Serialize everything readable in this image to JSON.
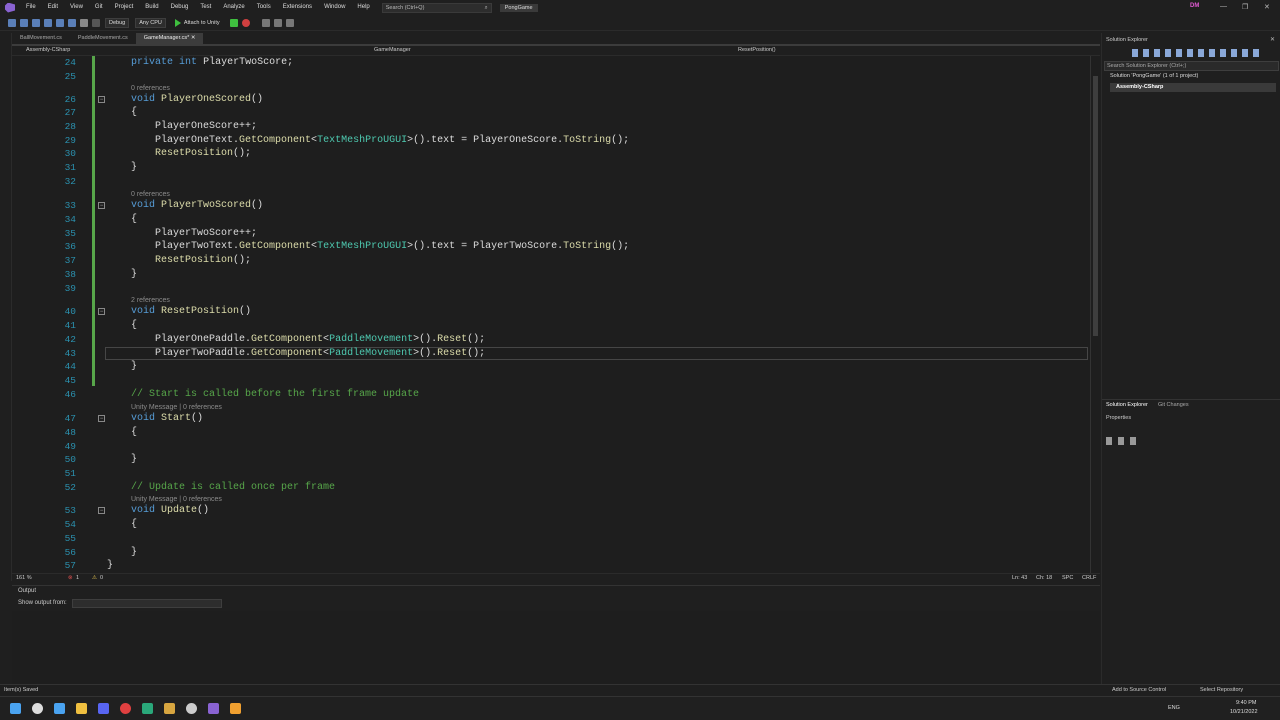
{
  "menu": {
    "items": [
      "File",
      "Edit",
      "View",
      "Git",
      "Project",
      "Build",
      "Debug",
      "Test",
      "Analyze",
      "Tools",
      "Extensions",
      "Window",
      "Help"
    ],
    "search_placeholder": "Search (Ctrl+Q)",
    "project": "PongGame",
    "user_initials": "DM"
  },
  "toolbar": {
    "config": "Debug",
    "platform": "Any CPU",
    "attach": "Attach to Unity"
  },
  "tabs": [
    {
      "label": "BallMovement.cs"
    },
    {
      "label": "PaddleMovement.cs"
    },
    {
      "label": "GameManager.cs*"
    }
  ],
  "navbar": {
    "assembly": "Assembly-CSharp",
    "class": "GameManager",
    "member": "ResetPosition()"
  },
  "editor": {
    "line_numbers": [
      "24",
      "25",
      "26",
      "27",
      "28",
      "29",
      "30",
      "31",
      "32",
      "33",
      "34",
      "35",
      "36",
      "37",
      "38",
      "39",
      "40",
      "41",
      "42",
      "43",
      "44",
      "45",
      "46",
      "47",
      "48",
      "49",
      "50",
      "51",
      "52",
      "53",
      "54",
      "55",
      "56",
      "57"
    ],
    "codelens": [
      "0 references",
      "0 references",
      "2 references",
      "Unity Message | 0 references",
      "Unity Message | 0 references"
    ]
  },
  "statusline": {
    "zoom": "161 %",
    "errors": "1",
    "warnings": "0",
    "position": "Ln: 43",
    "column": "Ch: 18",
    "spacing": "SPC",
    "eol": "CRLF"
  },
  "output": {
    "title": "Output",
    "show_from": "Show output from:"
  },
  "solution_explorer": {
    "title": "Solution Explorer",
    "search": "Search Solution Explorer (Ctrl+;)",
    "solution": "Solution 'PongGame' (1 of 1 project)",
    "project": "Assembly-CSharp",
    "tab1": "Solution Explorer",
    "tab2": "Git Changes",
    "properties": "Properties"
  },
  "statusbar": {
    "message": "Item(s) Saved",
    "source_control": "Add to Source Control",
    "repo": "Select Repository"
  },
  "taskbar": {
    "lang": "ENG",
    "time": "9:40 PM",
    "date": "10/21/2022"
  },
  "colors": {
    "accent": "#007acc",
    "background": "#1e1e1e",
    "keyword": "#569cd6",
    "type": "#4ec9b0",
    "method": "#dcdcaa",
    "comment": "#57a64a",
    "line_number": "#2b91af"
  }
}
